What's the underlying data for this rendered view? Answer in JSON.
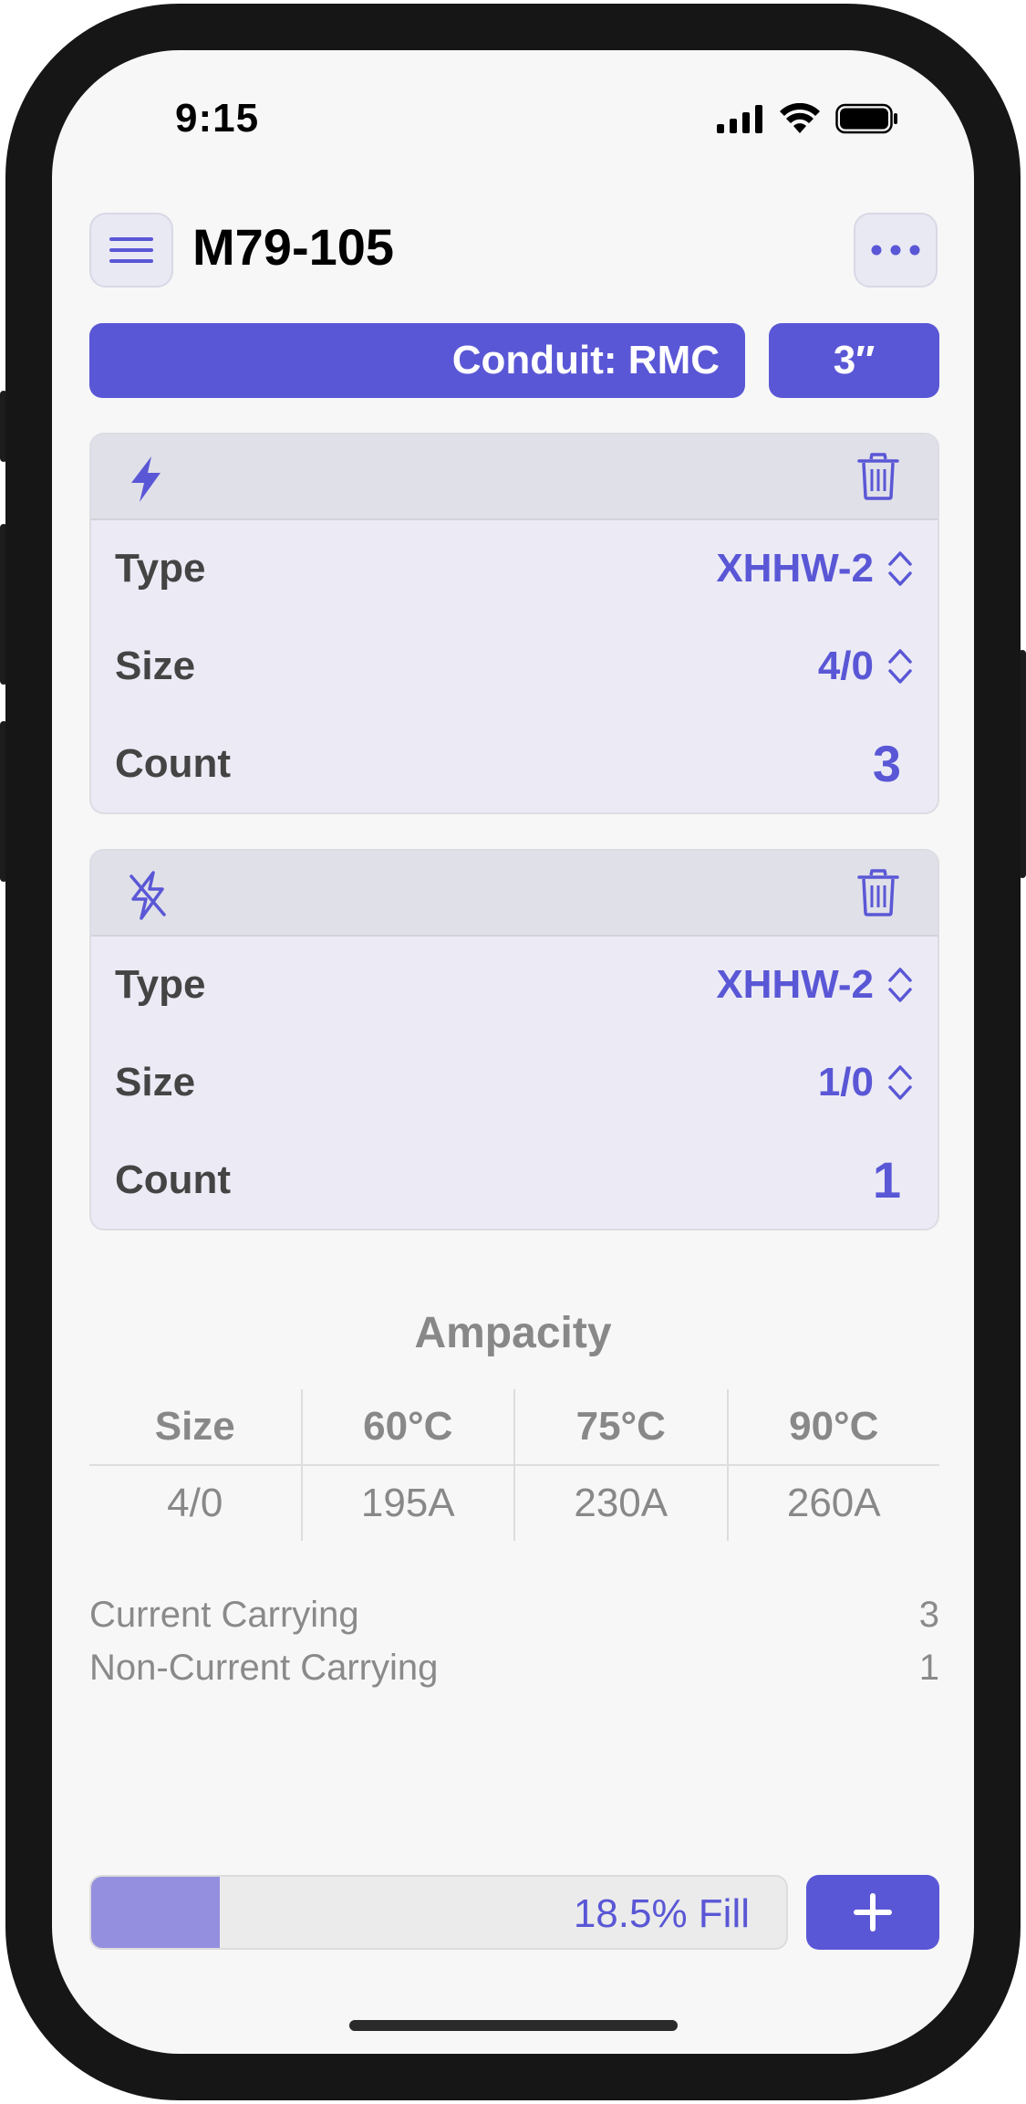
{
  "status_bar": {
    "time": "9:15"
  },
  "header": {
    "title": "M79-105",
    "menu_icon": "hamburger-icon",
    "more_icon": "ellipsis-icon"
  },
  "conduit": {
    "type_label": "Conduit: RMC",
    "size_label": "3′′"
  },
  "conductors": [
    {
      "kind_icon": "bolt-icon",
      "type_label": "Type",
      "type_value": "XHHW-2",
      "size_label": "Size",
      "size_value": "4/0",
      "count_label": "Count",
      "count_value": "3"
    },
    {
      "kind_icon": "bolt-slash-icon",
      "type_label": "Type",
      "type_value": "XHHW-2",
      "size_label": "Size",
      "size_value": "1/0",
      "count_label": "Count",
      "count_value": "1"
    }
  ],
  "ampacity": {
    "title": "Ampacity",
    "headers": [
      "Size",
      "60°C",
      "75°C",
      "90°C"
    ],
    "row": [
      "4/0",
      "195A",
      "230A",
      "260A"
    ]
  },
  "summary": {
    "current_label": "Current Carrying",
    "current_value": "3",
    "noncurrent_label": "Non-Current Carrying",
    "noncurrent_value": "1"
  },
  "fill": {
    "label": "18.5% Fill",
    "fraction": 0.185
  },
  "colors": {
    "accent": "#5a57d6",
    "fill_bar": "#9490df"
  }
}
